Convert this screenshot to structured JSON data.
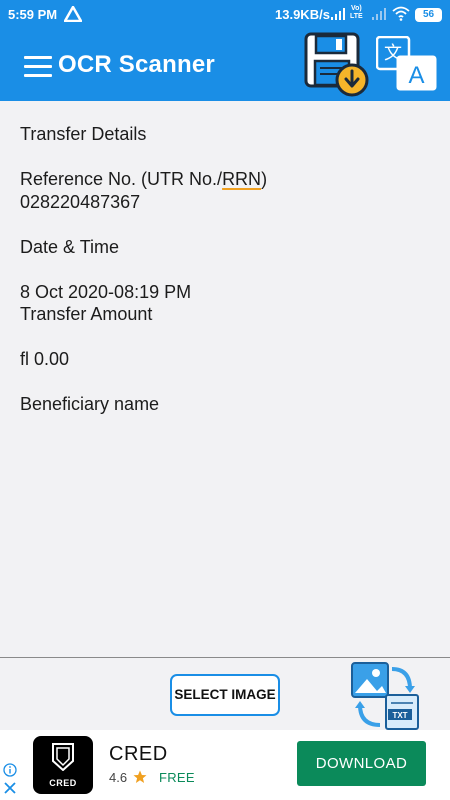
{
  "status_bar": {
    "time": "5:59 PM",
    "net_speed": "13.9KB/s",
    "volte_top": "Vo)",
    "volte_bottom": "LTE",
    "battery": "56"
  },
  "app_bar": {
    "title": "OCR Scanner",
    "color": "#1a8ee6",
    "icons": [
      "menu-icon",
      "save-file-icon",
      "translate-icon"
    ]
  },
  "ocr_result": {
    "lines": [
      "Transfer Details",
      "",
      "Reference No. (UTR No./RRN)",
      "028220487367",
      "",
      "Date & Time",
      "",
      "8 Oct 2020-08:19 PM",
      "Transfer Amount",
      "",
      "fl 0.00",
      "",
      "Beneficiary name"
    ]
  },
  "bottom_panel": {
    "select_image_label": "SELECT IMAGE",
    "convert_icon": "image-to-txt-icon",
    "txt_label": "TXT"
  },
  "ad": {
    "app_name": "CRED",
    "logo_text": "CRED",
    "rating": "4.6",
    "price": "FREE",
    "cta": "DOWNLOAD",
    "cta_color": "#0b8a5a"
  }
}
